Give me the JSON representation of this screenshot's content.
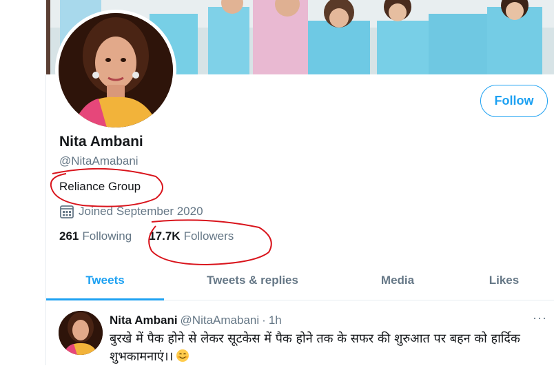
{
  "profile": {
    "name": "Nita Ambani",
    "handle": "@NitaAmabani",
    "bio": "Reliance Group",
    "joined": "Joined September 2020",
    "follow_label": "Follow"
  },
  "stats": {
    "following_count": "261",
    "following_label": "Following",
    "followers_count": "17.7K",
    "followers_label": "Followers"
  },
  "tabs": [
    {
      "label": "Tweets",
      "active": true
    },
    {
      "label": "Tweets & replies",
      "active": false
    },
    {
      "label": "Media",
      "active": false
    },
    {
      "label": "Likes",
      "active": false
    }
  ],
  "tweet": {
    "name": "Nita Ambani",
    "handle": "@NitaAmabani",
    "separator": "·",
    "time": "1h",
    "more": "···",
    "text": "बुरखे में पैक होने से लेकर सूटकेस में पैक होने तक के सफर की शुरुआत पर बहन को हार्दिक शुभकामनाएं।।"
  },
  "colors": {
    "accent": "#1da1f2",
    "secondary_text": "#657786",
    "annotation": "#d9141c"
  },
  "icons": {
    "calendar": "calendar-icon",
    "more": "more-horizontal-icon",
    "emoji": "smiling-face-emoji"
  }
}
